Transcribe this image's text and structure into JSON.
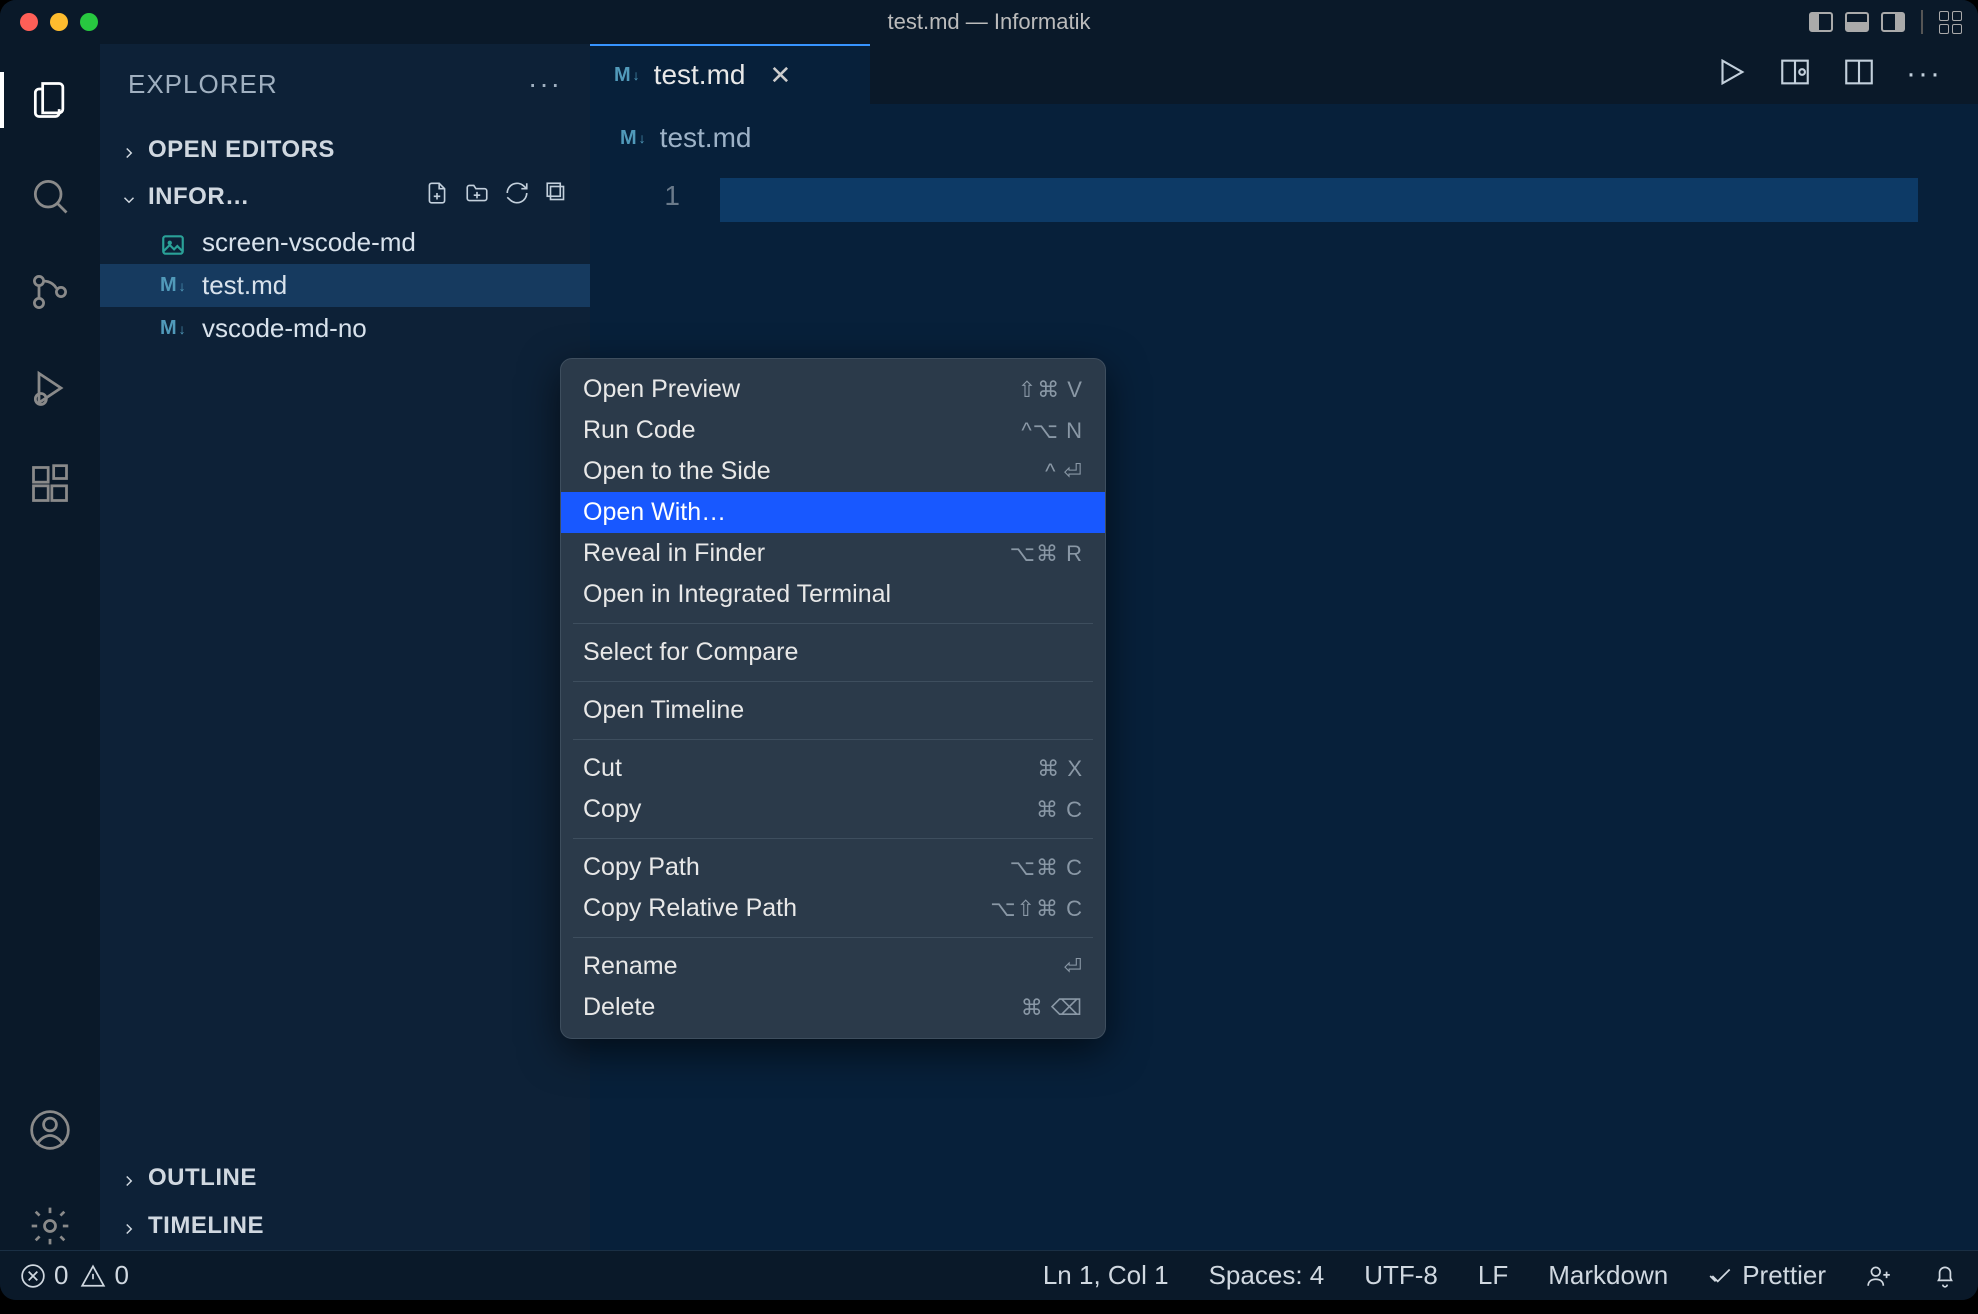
{
  "window": {
    "title": "test.md — Informatik"
  },
  "sidebar": {
    "title": "EXPLORER",
    "open_editors": "OPEN EDITORS",
    "folder_name": "INFOR…",
    "files": [
      {
        "name": "screen-vscode-md",
        "icon": "image"
      },
      {
        "name": "test.md",
        "icon": "markdown",
        "selected": true
      },
      {
        "name": "vscode-md-no",
        "icon": "markdown"
      }
    ],
    "outline": "OUTLINE",
    "timeline": "TIMELINE"
  },
  "tabs": {
    "active": {
      "label": "test.md",
      "icon": "markdown"
    }
  },
  "breadcrumb": {
    "file": "test.md"
  },
  "editor": {
    "line_number": "1"
  },
  "context_menu": {
    "groups": [
      [
        {
          "label": "Open Preview",
          "shortcut": "⇧⌘ V"
        },
        {
          "label": "Run Code",
          "shortcut": "^⌥ N"
        },
        {
          "label": "Open to the Side",
          "shortcut": "^ ⏎"
        },
        {
          "label": "Open With…",
          "shortcut": "",
          "highlighted": true
        },
        {
          "label": "Reveal in Finder",
          "shortcut": "⌥⌘ R"
        },
        {
          "label": "Open in Integrated Terminal",
          "shortcut": ""
        }
      ],
      [
        {
          "label": "Select for Compare",
          "shortcut": ""
        }
      ],
      [
        {
          "label": "Open Timeline",
          "shortcut": ""
        }
      ],
      [
        {
          "label": "Cut",
          "shortcut": "⌘ X"
        },
        {
          "label": "Copy",
          "shortcut": "⌘ C"
        }
      ],
      [
        {
          "label": "Copy Path",
          "shortcut": "⌥⌘ C"
        },
        {
          "label": "Copy Relative Path",
          "shortcut": "⌥⇧⌘ C"
        }
      ],
      [
        {
          "label": "Rename",
          "shortcut": "⏎"
        },
        {
          "label": "Delete",
          "shortcut": "⌘ ⌫"
        }
      ]
    ]
  },
  "status": {
    "errors": "0",
    "warnings": "0",
    "position": "Ln 1, Col 1",
    "spaces": "Spaces: 4",
    "encoding": "UTF-8",
    "eol": "LF",
    "language": "Markdown",
    "prettier": "Prettier"
  }
}
